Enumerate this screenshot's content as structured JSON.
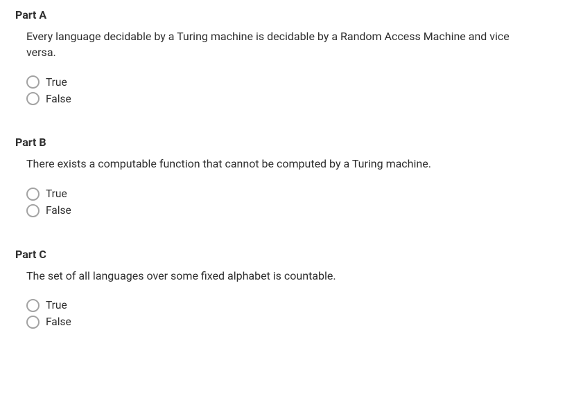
{
  "parts": [
    {
      "title": "Part A",
      "question": "Every language decidable by a Turing machine is decidable by a Random Access Machine and vice versa.",
      "options": [
        "True",
        "False"
      ]
    },
    {
      "title": "Part B",
      "question": "There exists a computable function that cannot be computed by a Turing machine.",
      "options": [
        "True",
        "False"
      ]
    },
    {
      "title": "Part C",
      "question": "The set of all languages over some fixed alphabet is countable.",
      "options": [
        "True",
        "False"
      ]
    }
  ]
}
